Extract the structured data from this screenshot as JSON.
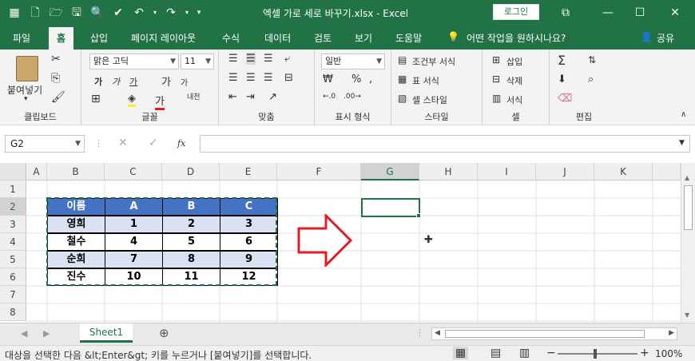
{
  "window": {
    "title": "엑셀 가로 세로 바꾸기.xlsx  -  Excel",
    "login_label": "로그인"
  },
  "tabs": [
    "파일",
    "홈",
    "삽입",
    "페이지 레이아웃",
    "수식",
    "데이터",
    "검토",
    "보기",
    "도움말"
  ],
  "tell_me": "어떤 작업을 원하시나요?",
  "share_label": "공유",
  "ribbon": {
    "clipboard": {
      "label": "클립보드",
      "paste": "붙여넣기"
    },
    "font": {
      "label": "글꼴",
      "name": "맑은 고딕",
      "size": "11",
      "bold": "가",
      "italic": "가",
      "underline": "가",
      "grow": "가",
      "shrink": "가",
      "phonetic": "내천",
      "fontcolor": "가"
    },
    "align": {
      "label": "맞춤"
    },
    "number": {
      "label": "표시 형식",
      "format": "일반"
    },
    "styles": {
      "label": "스타일",
      "cond": "조건부 서식",
      "table": "표 서식",
      "cell": "셀 스타일"
    },
    "cells": {
      "label": "셀",
      "insert": "삽입",
      "delete": "삭제",
      "format": "서식"
    },
    "edit": {
      "label": "편집"
    }
  },
  "formula_bar": {
    "name_box": "G2",
    "fx": "fx",
    "value": ""
  },
  "columns": [
    "A",
    "B",
    "C",
    "D",
    "E",
    "F",
    "G",
    "H",
    "I",
    "J",
    "K"
  ],
  "rows": [
    "1",
    "2",
    "3",
    "4",
    "5",
    "6",
    "7",
    "8"
  ],
  "table": {
    "header": [
      "이름",
      "A",
      "B",
      "C"
    ],
    "rows": [
      [
        "영희",
        "1",
        "2",
        "3"
      ],
      [
        "철수",
        "4",
        "5",
        "6"
      ],
      [
        "순희",
        "7",
        "8",
        "9"
      ],
      [
        "진수",
        "10",
        "11",
        "12"
      ]
    ]
  },
  "sheet_tab": "Sheet1",
  "status": {
    "message": "대상을 선택한 다음 &lt;Enter&gt; 키를 누르거나 [붙여넣기]를 선택합니다.",
    "zoom": "100%"
  },
  "colors": {
    "accent": "#217346",
    "header_fill": "#4472c4",
    "band_fill": "#d9e1f2",
    "arrow": "#e01c24"
  }
}
